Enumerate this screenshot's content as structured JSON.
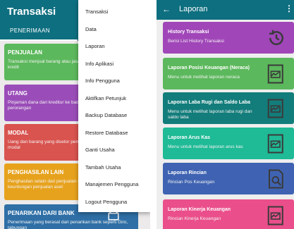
{
  "left": {
    "app_title": "Transaksi",
    "tab_label": "PENERIMAAN",
    "cards": [
      {
        "title": "PENJUALAN",
        "desc": "Transaksi menjual barang atau jasa baik secara tunai maupun kredit"
      },
      {
        "title": "UTANG",
        "desc": "Pinjaman dana dari kreditur ke badan usaha maupun perorangan"
      },
      {
        "title": "MODAL",
        "desc": "Uang dan barang yang disetor pemilik badan usaha sebagai modal"
      },
      {
        "title": "PENGHASILAN LAIN",
        "desc": "Penghasilan selain dari penjualan seperti: penghasilan bunga, keuntungan penjualan aset"
      },
      {
        "title": "PENARIKAN DARI BANK",
        "desc": "Penerimaan yang berasal dari penarikan bank seperti Giro, tabungan"
      }
    ]
  },
  "menu": {
    "items": [
      "Transaksi",
      "Data",
      "Laporan",
      "Info Aplikasi",
      "Info Pengguna",
      "Aktifkan Petunjuk",
      "Backup Database",
      "Restore Database",
      "Ganti Usaha",
      "Tambah Usaha",
      "Manajemen Pengguna",
      "Logout Pengguna"
    ]
  },
  "right": {
    "app_title": "Laporan",
    "back_icon": "arrow-left-icon",
    "more_icon": "more-vertical-icon",
    "cards": [
      {
        "title": "History Transaksi",
        "desc": "Berisi List History Transaksi",
        "icon": "history-icon"
      },
      {
        "title": "Laporan Posisi Keuangan (Neraca)",
        "desc": "Menu untuk melihat laporan neraca",
        "icon": "chart-report-icon"
      },
      {
        "title": "Laporan Laba Rugi dan Saldo Laba",
        "desc": "Menu untuk melihat laporan laba rugi dan saldo laba",
        "icon": "chart-report-icon"
      },
      {
        "title": "Laporan Arus Kas",
        "desc": "Menu untuk melihat laporan arus kas",
        "icon": "chart-report-icon"
      },
      {
        "title": "Laporan Rincian",
        "desc": "Rincian Pos Keuangan",
        "icon": "search-document-icon"
      },
      {
        "title": "Laporan Kinerja Keuangan",
        "desc": "Rincian Kinerja Keuangan",
        "icon": "chart-report-icon"
      }
    ]
  }
}
